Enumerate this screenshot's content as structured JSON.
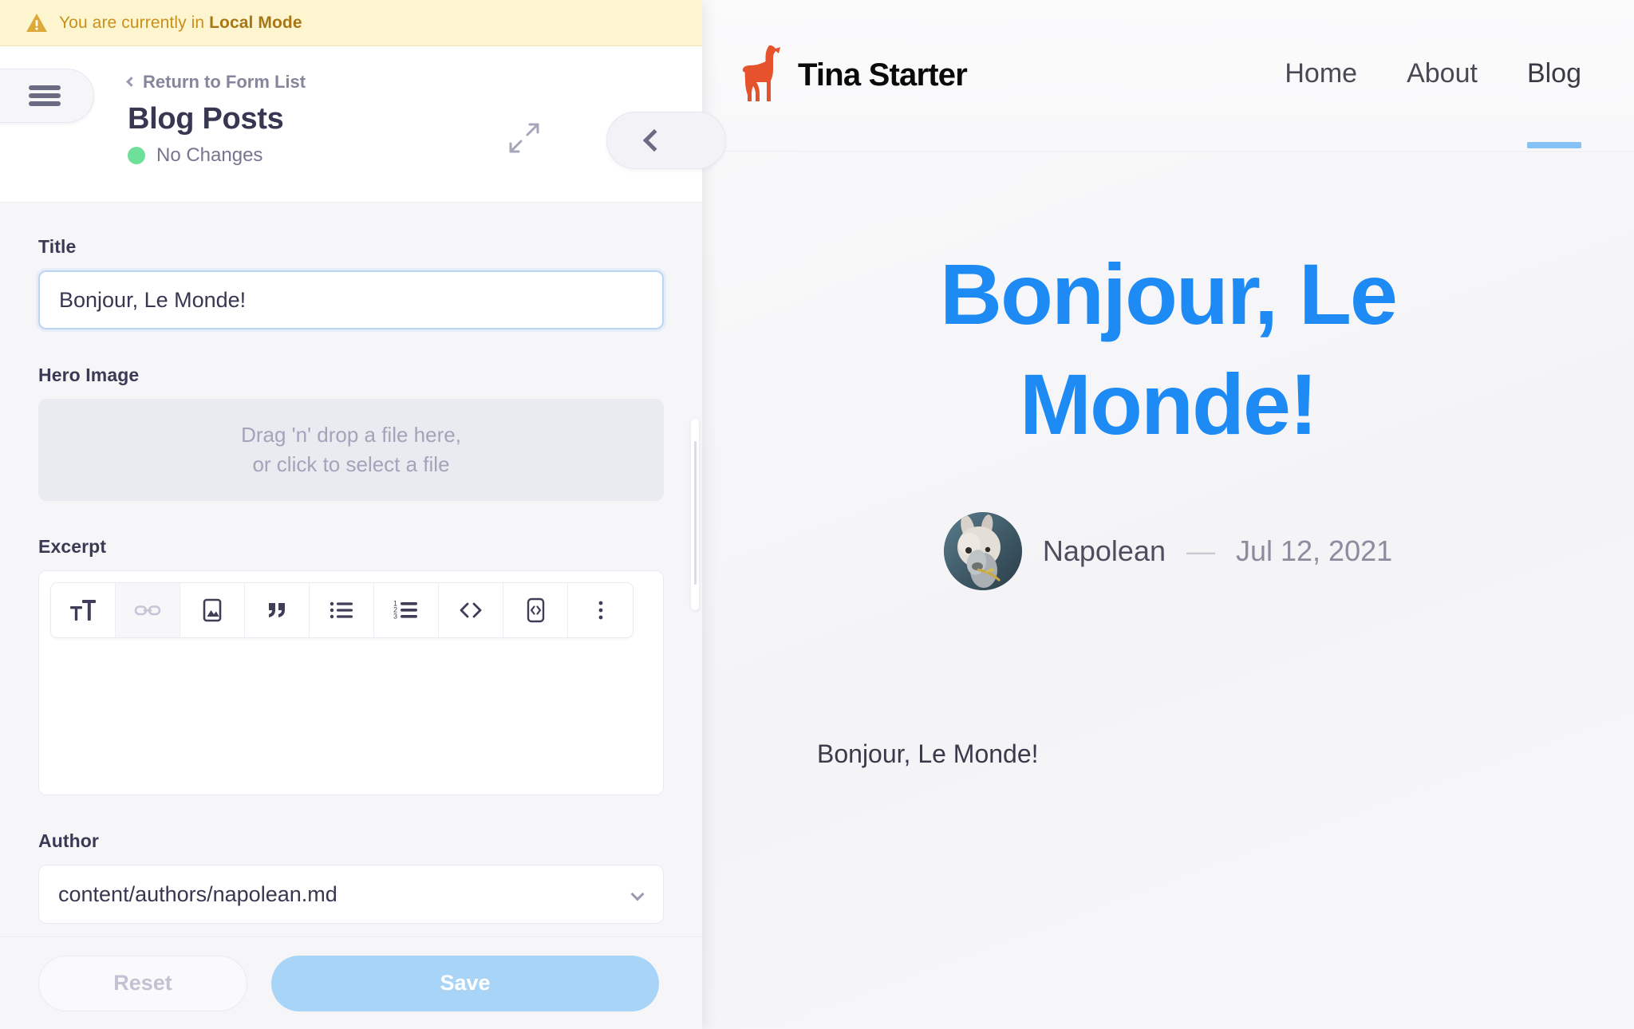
{
  "banner": {
    "icon": "warning-triangle-icon",
    "text_prefix": "You are currently in ",
    "text_strong": "Local Mode",
    "bg_color": "#FCF5CF",
    "text_color": "#C9901A"
  },
  "sidebar": {
    "menu_icon": "hamburger-icon",
    "return_link": "Return to Form List",
    "title": "Blog Posts",
    "status": {
      "label": "No Changes",
      "dot_color": "#6FE09A"
    },
    "expand_icon": "expand-arrows-icon",
    "collapse_icon": "chevron-left-icon",
    "fields": [
      {
        "id": "title",
        "label": "Title",
        "type": "text",
        "value": "Bonjour, Le Monde!",
        "placeholder": ""
      },
      {
        "id": "hero_image",
        "label": "Hero Image",
        "type": "dropzone",
        "line1": "Drag 'n' drop a file here,",
        "line2": "or click to select a file"
      },
      {
        "id": "excerpt",
        "label": "Excerpt",
        "type": "richtext",
        "value": "",
        "toolbar": [
          {
            "name": "text-size-icon",
            "label": "Text size",
            "disabled": false
          },
          {
            "name": "link-icon",
            "label": "Link",
            "disabled": true
          },
          {
            "name": "image-icon",
            "label": "Image",
            "disabled": false
          },
          {
            "name": "quote-icon",
            "label": "Quote",
            "disabled": false
          },
          {
            "name": "bullet-list-icon",
            "label": "Bulleted list",
            "disabled": false
          },
          {
            "name": "numbered-list-icon",
            "label": "Numbered list",
            "disabled": false
          },
          {
            "name": "code-icon",
            "label": "Inline code",
            "disabled": false
          },
          {
            "name": "code-block-icon",
            "label": "Code block",
            "disabled": false
          },
          {
            "name": "more-vertical-icon",
            "label": "More",
            "disabled": false
          }
        ]
      },
      {
        "id": "author",
        "label": "Author",
        "type": "select",
        "value": "content/authors/napolean.md"
      }
    ],
    "footer": {
      "reset_label": "Reset",
      "save_label": "Save",
      "save_color": "#A8D4F7"
    }
  },
  "preview": {
    "brand": {
      "logo_icon": "llama-logo-icon",
      "logo_color": "#E6522C",
      "name": "Tina Starter"
    },
    "nav": [
      {
        "label": "Home",
        "active": false
      },
      {
        "label": "About",
        "active": false
      },
      {
        "label": "Blog",
        "active": true
      }
    ],
    "nav_accent_color": "#85C3F5",
    "article": {
      "title": "Bonjour, Le Monde!",
      "title_color": "#1E8BF5",
      "author": "Napolean",
      "separator": "—",
      "date": "Jul 12, 2021",
      "avatar_icon": "llama-photo-avatar",
      "body": "Bonjour, Le Monde!"
    }
  }
}
